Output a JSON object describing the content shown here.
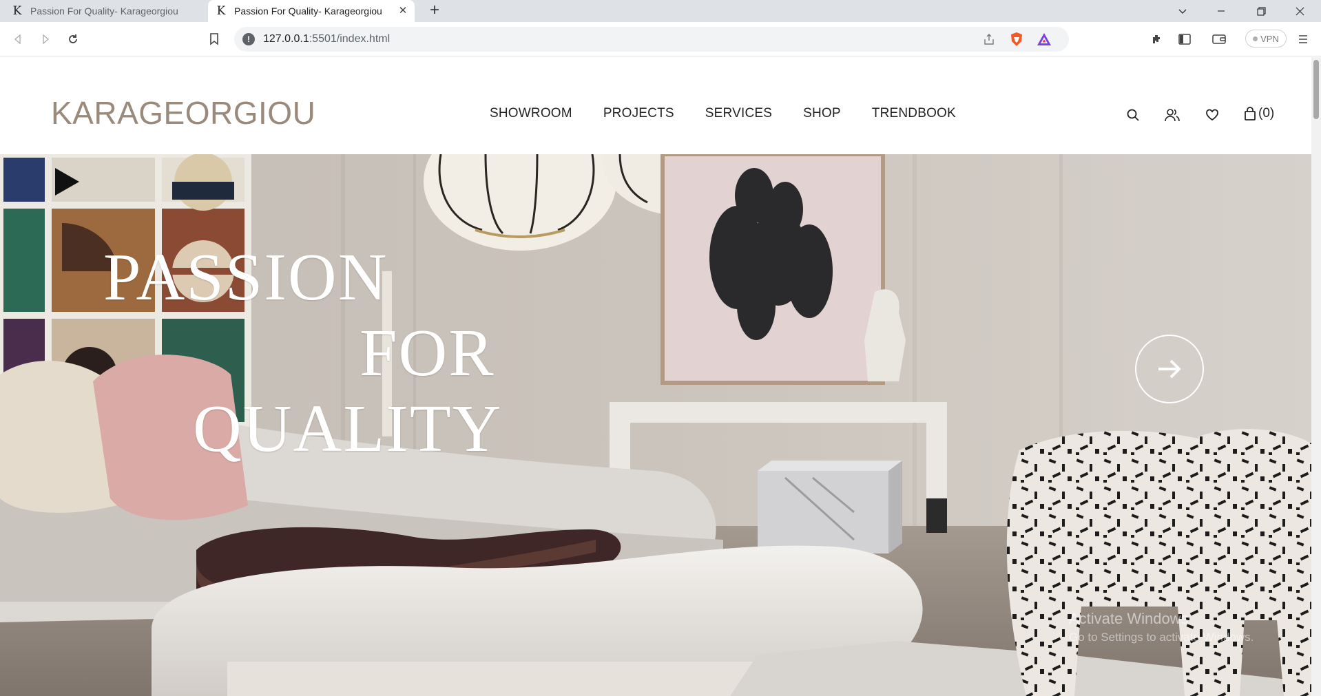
{
  "browser": {
    "tabs": [
      {
        "favicon": "K",
        "title": "Passion For Quality- Karageorgiou"
      },
      {
        "favicon": "K",
        "title": "Passion For Quality- Karageorgiou"
      }
    ],
    "url_host": "127.0.0.1",
    "url_path": ":5501/index.html",
    "vpn_label": "VPN"
  },
  "site": {
    "logo": "KARAGEORGIOU",
    "nav": [
      "SHOWROOM",
      "PROJECTS",
      "SERVICES",
      "SHOP",
      "TRENDBOOK"
    ],
    "cart_count": "(0)"
  },
  "hero": {
    "line1": "PASSION",
    "line2": "FOR",
    "line3": "QUALITY"
  },
  "os": {
    "watermark_title": "Activate Windows",
    "watermark_sub": "Go to Settings to activate Windows."
  },
  "misc": {
    "cursor_glyph": "i"
  }
}
